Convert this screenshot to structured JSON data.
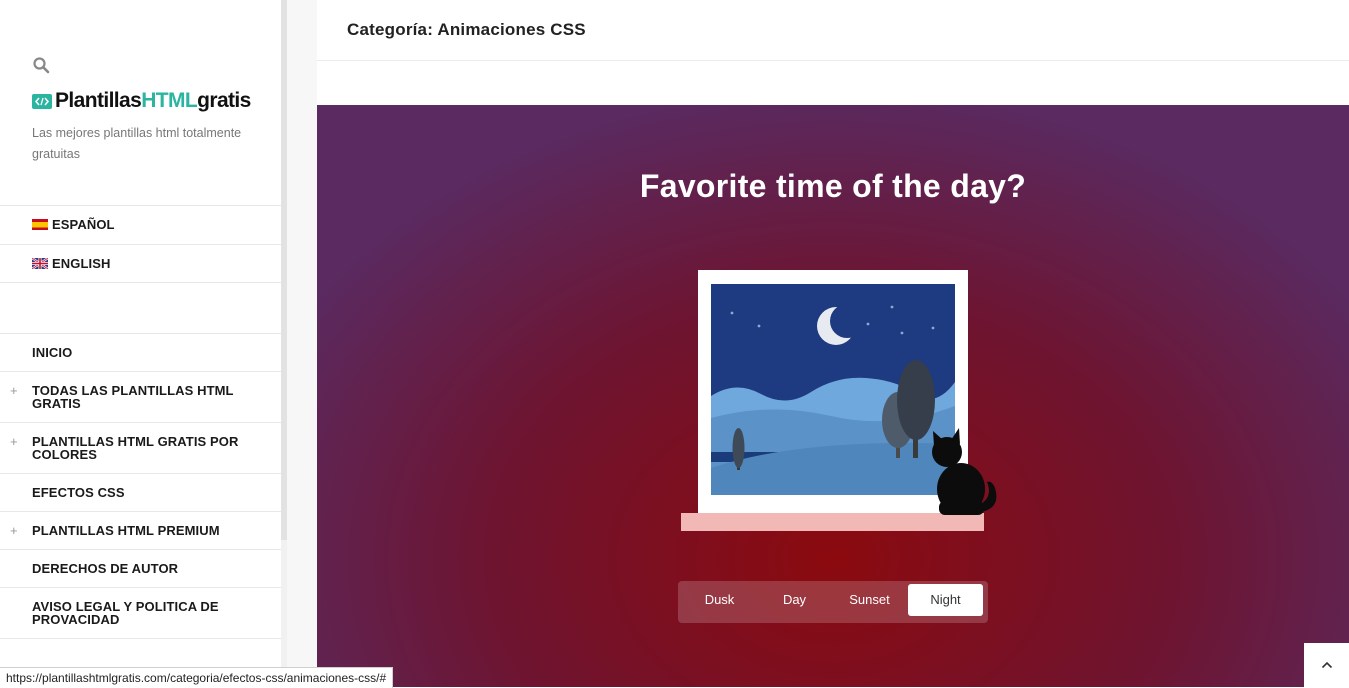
{
  "sidebar": {
    "logo": {
      "text_a": "Plantillas",
      "text_b": "HTML",
      "text_c": "gratis"
    },
    "tagline": "Las mejores plantillas html totalmente gratuitas",
    "languages": [
      {
        "label": "ESPAÑOL",
        "flag": "es-flag"
      },
      {
        "label": "ENGLISH",
        "flag": "uk-flag"
      }
    ],
    "menu": [
      {
        "label": "INICIO",
        "expandable": false
      },
      {
        "label": "TODAS LAS PLANTILLAS HTML GRATIS",
        "expandable": true
      },
      {
        "label": "PLANTILLAS HTML GRATIS POR COLORES",
        "expandable": true
      },
      {
        "label": "EFECTOS CSS",
        "expandable": false
      },
      {
        "label": "PLANTILLAS HTML PREMIUM",
        "expandable": true
      },
      {
        "label": "DERECHOS DE AUTOR",
        "expandable": false
      },
      {
        "label": "AVISO LEGAL Y POLITICA DE PROVACIDAD",
        "expandable": false
      }
    ],
    "expand_glyph": "+"
  },
  "header": {
    "title": "Categoría: Animaciones CSS"
  },
  "hero": {
    "title": "Favorite time of the day?",
    "options": [
      {
        "label": "Dusk",
        "active": false
      },
      {
        "label": "Day",
        "active": false
      },
      {
        "label": "Sunset",
        "active": false
      },
      {
        "label": "Night",
        "active": true
      }
    ]
  },
  "status_bar": {
    "url": "https://plantillashtmlgratis.com/categoria/efectos-css/animaciones-css/#"
  },
  "icons": {
    "search": "search-icon",
    "back_to_top": "chevron-up-icon",
    "logo": "code-icon"
  },
  "colors": {
    "accent": "#2bb5a0",
    "hero_center": "#8b0a0f",
    "hero_edge": "#5a2a60",
    "night_sky": "#1e3a80"
  }
}
